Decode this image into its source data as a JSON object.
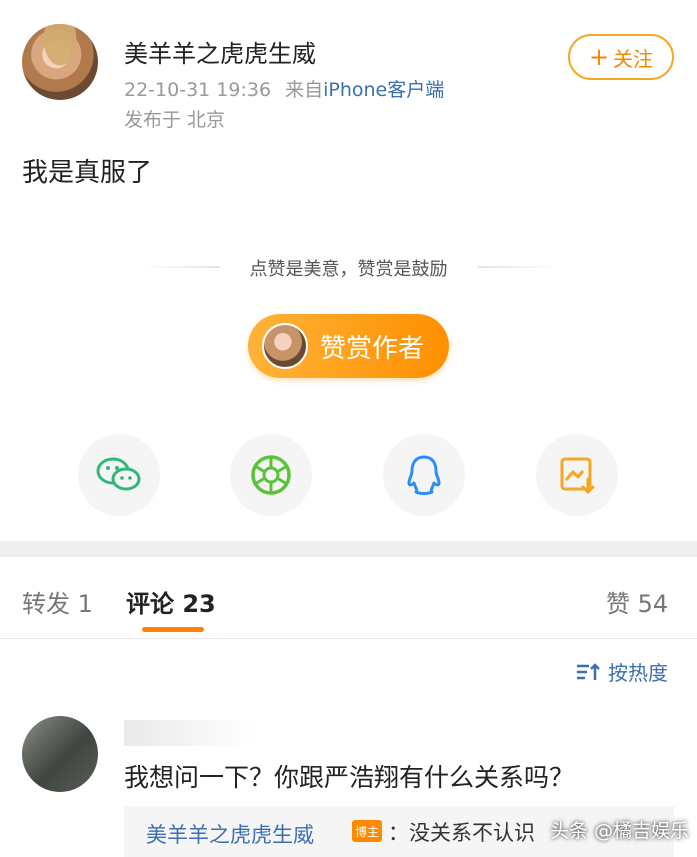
{
  "post": {
    "username": "美羊羊之虎虎生威",
    "time": "22-10-31 19:36",
    "source_prefix": "来自",
    "source": "iPhone客户端",
    "location": "发布于 北京",
    "follow_label": "关注",
    "content": "我是真服了"
  },
  "reward": {
    "tagline": "点赞是美意，赞赏是鼓励",
    "button_label": "赞赏作者"
  },
  "share": [
    "wechat-icon",
    "moments-icon",
    "qq-icon",
    "save-image-icon"
  ],
  "tabs": {
    "repost": "转发 1",
    "comments": "评论 23",
    "likes": "赞 54"
  },
  "sort_label": "按热度",
  "comment": {
    "text": "我想问一下？你跟严浩翔有什么关系吗？",
    "reply_author": "美羊羊之虎虎生威",
    "reply_badge": "博主",
    "reply_text": "：没关系不认识"
  },
  "watermark": "头条 @橘吉娱乐",
  "colors": {
    "accent": "#ff8200",
    "link": "#3a6fb0"
  }
}
